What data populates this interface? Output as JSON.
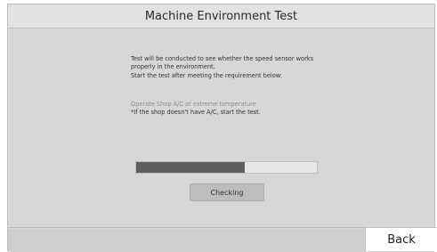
{
  "header": {
    "title": "Machine Environment Test"
  },
  "main": {
    "description_lines": [
      "Test will be conducted to see whether the speed sensor works",
      "properly in the environment.",
      "Start the test after meeting the requirement below:"
    ],
    "requirement": "Operate Shop A/C at extreme temperature",
    "requirement_note": "*If the shop doesn't have A/C, start the test.",
    "progress": 0.6,
    "checking_label": "Checking"
  },
  "footer": {
    "back_label": "Back"
  },
  "colors": {
    "progress_fill": "#5e5e5e",
    "progress_track": "#e6e6e6",
    "panel_bg": "#d7d7d7"
  }
}
